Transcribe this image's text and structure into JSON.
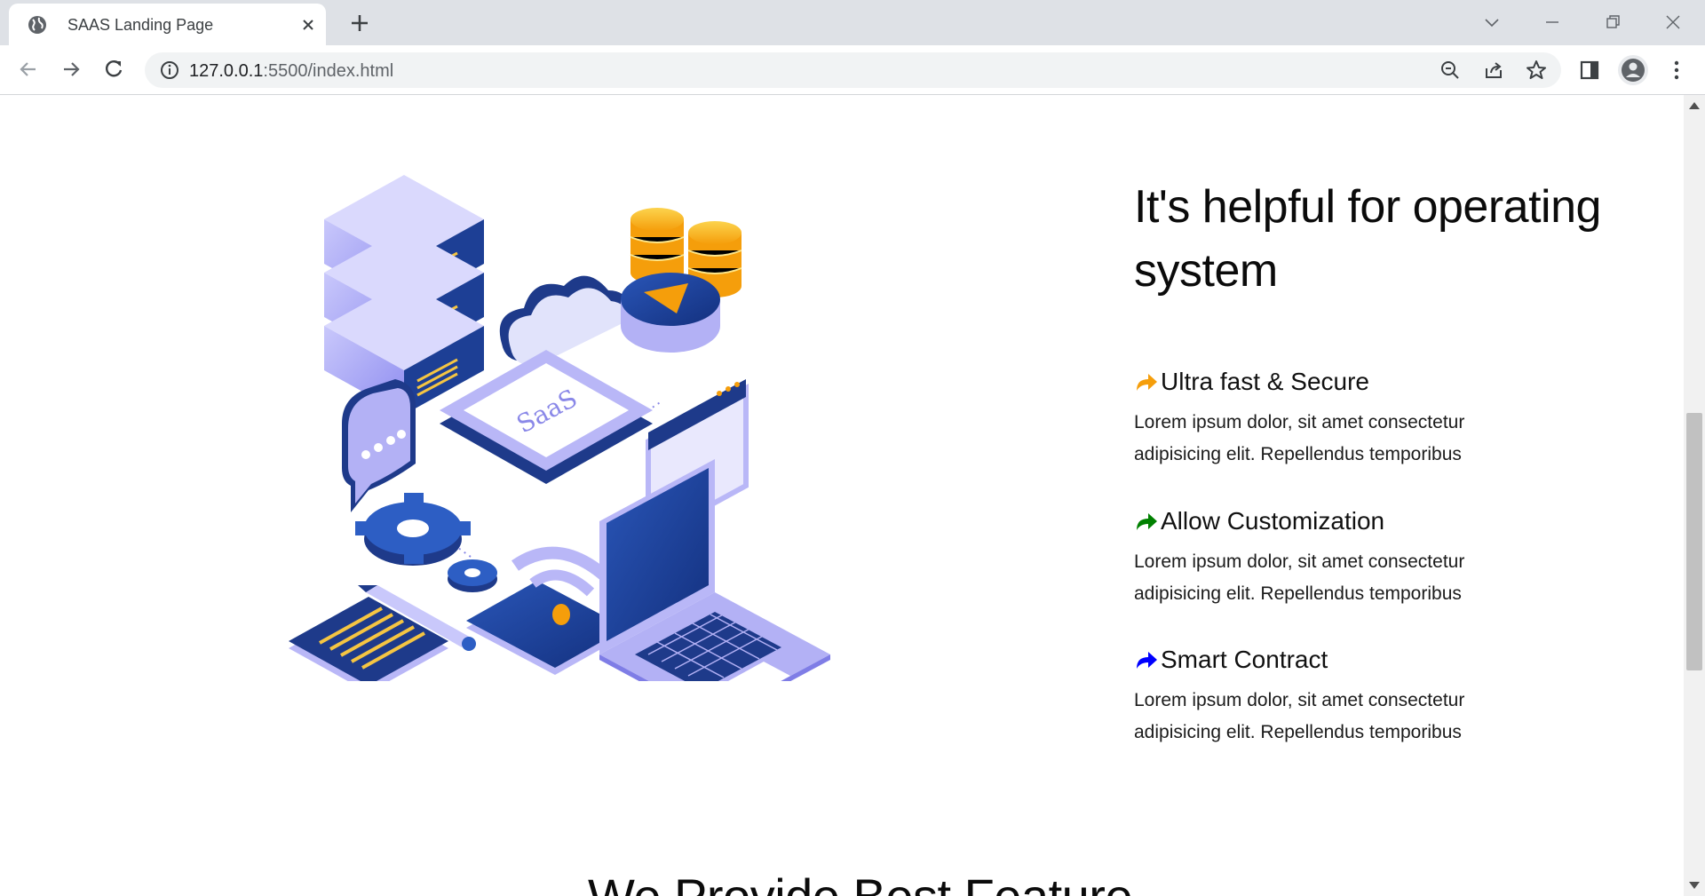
{
  "browser": {
    "tab_title": "SAAS Landing Page",
    "url_host": "127.0.0.1",
    "url_path": ":5500/index.html"
  },
  "page": {
    "heading": "It's helpful for operating system",
    "illustration_label": "SaaS",
    "features": [
      {
        "title": "Ultra fast & Secure",
        "description": "Lorem ipsum dolor, sit amet consectetur adipisicing elit. Repellendus temporibus",
        "icon": "share-arrow-icon",
        "color": "#f59e0b"
      },
      {
        "title": "Allow Customization",
        "description": "Lorem ipsum dolor, sit amet consectetur adipisicing elit. Repellendus temporibus",
        "icon": "share-arrow-icon",
        "color": "#008000"
      },
      {
        "title": "Smart Contract",
        "description": "Lorem ipsum dolor, sit amet consectetur adipisicing elit. Repellendus temporibus",
        "icon": "share-arrow-icon",
        "color": "#0000ff"
      }
    ],
    "next_section_title": "We Provide Best Feature"
  },
  "colors": {
    "illustration_dark": "#1e3a8a",
    "illustration_light": "#a5a3f0",
    "coin": "#fbbf24"
  }
}
